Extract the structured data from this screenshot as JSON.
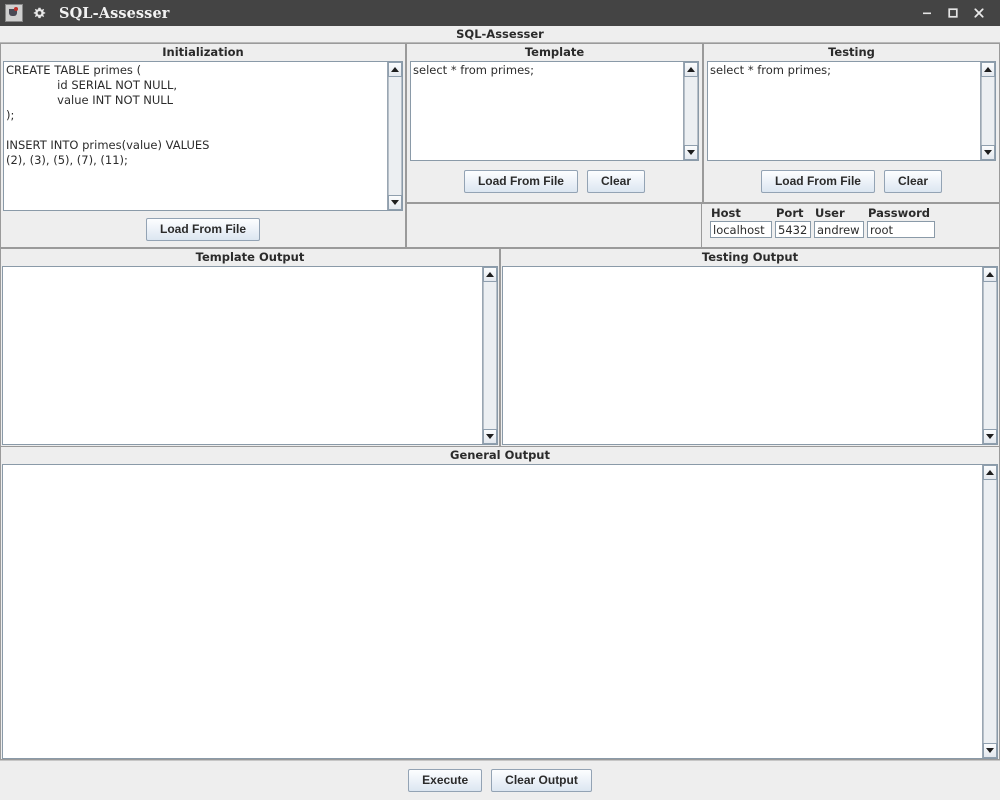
{
  "window": {
    "title": "SQL-Assesser",
    "app_icon": "java-app-icon",
    "menu_icon": "gear-icon",
    "minimize_label": "–",
    "maximize_label": "□",
    "close_label": "✕",
    "titlebar_color": "#444444",
    "background_color": "#eeeeee"
  },
  "app": {
    "header_title": "SQL-Assesser"
  },
  "initialization": {
    "title": "Initialization",
    "text": "CREATE TABLE primes (\n              id SERIAL NOT NULL,\n              value INT NOT NULL\n);\n\nINSERT INTO primes(value) VALUES\n(2), (3), (5), (7), (11);",
    "load_button": "Load From File"
  },
  "template": {
    "title": "Template",
    "text": "select * from primes;",
    "load_button": "Load From File",
    "clear_button": "Clear"
  },
  "testing": {
    "title": "Testing",
    "text": "select * from primes;",
    "load_button": "Load From File",
    "clear_button": "Clear"
  },
  "connection": {
    "host": {
      "label": "Host",
      "value": "localhost"
    },
    "port": {
      "label": "Port",
      "value": "5432"
    },
    "user": {
      "label": "User",
      "value": "andrew"
    },
    "password": {
      "label": "Password",
      "value": "root"
    }
  },
  "template_output": {
    "title": "Template Output",
    "text": ""
  },
  "testing_output": {
    "title": "Testing Output",
    "text": ""
  },
  "general_output": {
    "title": "General Output",
    "text": ""
  },
  "actions": {
    "execute_button": "Execute",
    "clear_output_button": "Clear Output"
  },
  "icons": {
    "scroll_up": "triangle-up-icon",
    "scroll_down": "triangle-down-icon"
  }
}
